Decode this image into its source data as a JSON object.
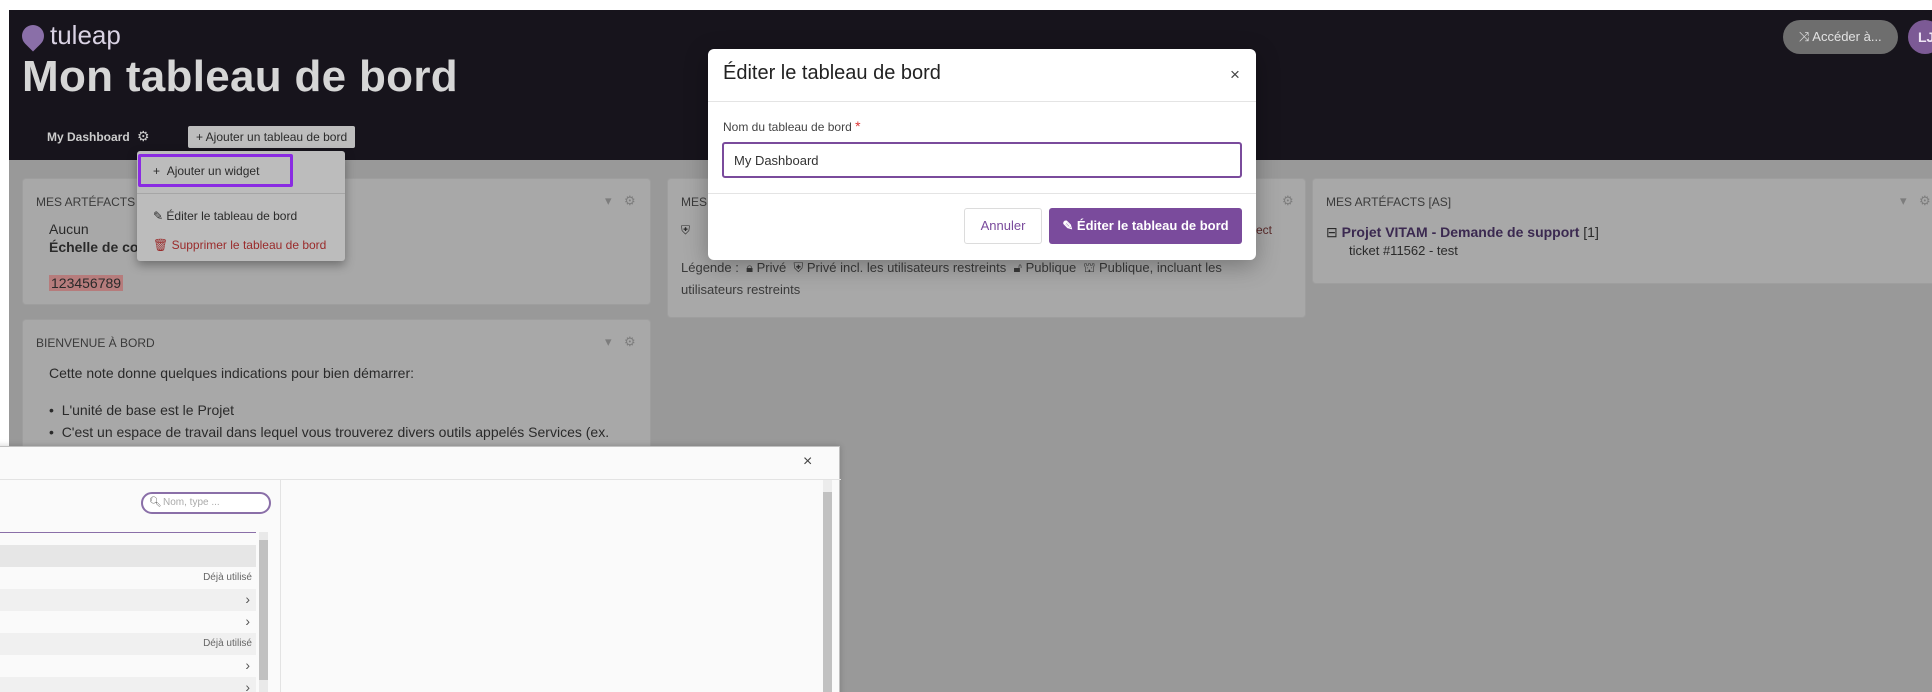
{
  "app": {
    "logo_text": "tuleap",
    "page_title": "Mon tableau de bord",
    "switch_button": "Accéder à...",
    "avatar_initials": "LJ"
  },
  "tabs": {
    "active": "My Dashboard",
    "add_dashboard": "+ Ajouter un tableau de bord"
  },
  "dropdown": {
    "add_widget": "Ajouter un widget",
    "edit_dashboard": "Éditer le tableau de bord",
    "delete_dashboard": "Supprimer le tableau de bord"
  },
  "widgets": {
    "my_artifacts": {
      "title": "MES ARTÉFACTS",
      "line1": "Aucun",
      "line2": "Échelle de co",
      "highlight": "123456789"
    },
    "my_projects": {
      "title": "MES",
      "truncated_link": "ect",
      "legend_prefix": "Légende :",
      "legend_private": "Privé",
      "legend_private_restricted": "Privé incl. les utilisateurs restreints",
      "legend_public": "Publique",
      "legend_public_restricted": "Publique, incluant les",
      "legend_public_restricted_2": "utilisateurs restreints"
    },
    "my_artifacts_as": {
      "title": "MES ARTÉFACTS [AS]",
      "project": "Projet VITAM - Demande de support",
      "count": "[1]",
      "ticket": "ticket #11562 - test"
    },
    "welcome": {
      "title": "BIENVENUE À BORD",
      "intro": "Cette note donne quelques indications pour bien démarrer:",
      "bullet1": "L'unité de base est le Projet",
      "bullet2": "C'est un espace de travail dans lequel vous trouverez divers outils appelés Services (ex."
    }
  },
  "add_widget_modal": {
    "search_placeholder": "Nom, type ...",
    "used_label": "Déjà utilisé"
  },
  "edit_modal": {
    "title": "Éditer le tableau de bord",
    "field_label": "Nom du tableau de bord",
    "required_mark": "*",
    "field_value": "My Dashboard",
    "cancel": "Annuler",
    "submit": "Éditer le tableau de bord"
  },
  "colors": {
    "brand_purple": "#7a4b9c",
    "highlight_border": "#8a2be2",
    "header_bg": "#17141c"
  }
}
